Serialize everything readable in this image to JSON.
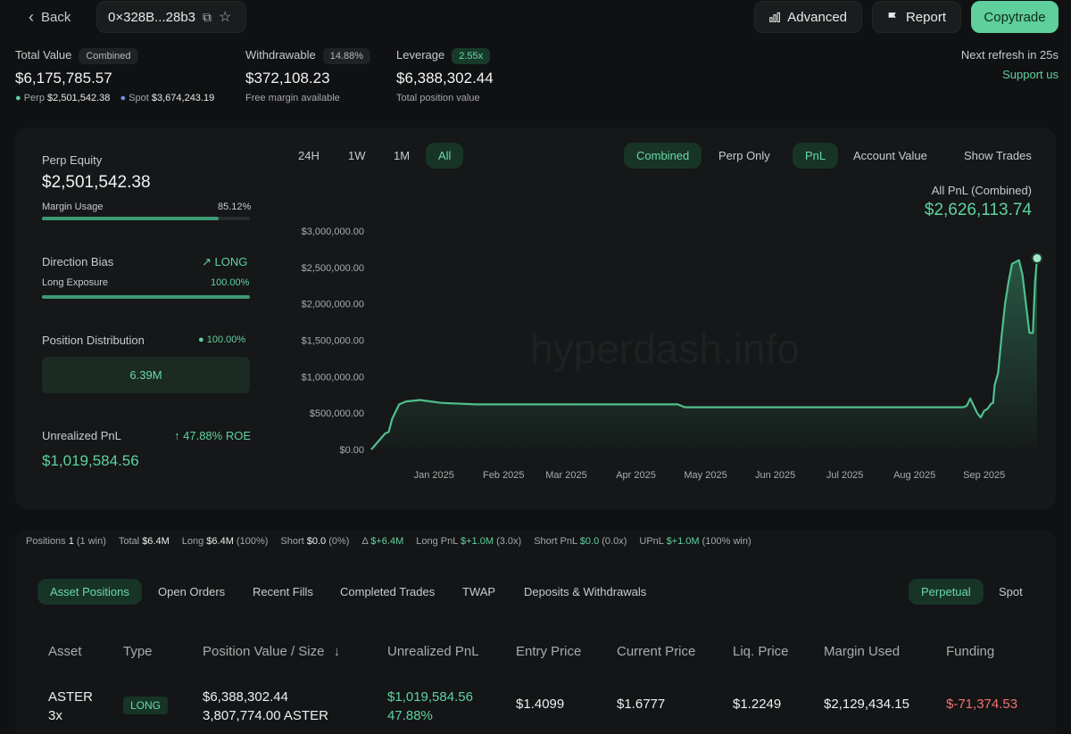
{
  "header": {
    "back_label": "Back",
    "address": "0×328B...28b3",
    "advanced_label": "Advanced",
    "report_label": "Report",
    "copytrade_label": "Copytrade",
    "refresh_text": "Next refresh in 25s",
    "support_label": "Support us"
  },
  "summary": {
    "total_value": {
      "label": "Total Value",
      "badge": "Combined",
      "value": "$6,175,785.57",
      "perp_label": "Perp",
      "perp_value": "$2,501,542.38",
      "spot_label": "Spot",
      "spot_value": "$3,674,243.19"
    },
    "withdrawable": {
      "label": "Withdrawable",
      "badge": "14.88%",
      "value": "$372,108.23",
      "sub": "Free margin available"
    },
    "leverage": {
      "label": "Leverage",
      "badge": "2.55x",
      "value": "$6,388,302.44",
      "sub": "Total position value"
    }
  },
  "left_panel": {
    "perp_equity_label": "Perp Equity",
    "perp_equity_value": "$2,501,542.38",
    "margin_usage_label": "Margin Usage",
    "margin_usage_value": "85.12%",
    "margin_usage_fraction": 0.8512,
    "direction_bias_label": "Direction Bias",
    "direction_bias_value": "LONG",
    "long_exposure_label": "Long Exposure",
    "long_exposure_value": "100.00%",
    "long_exposure_fraction": 1.0,
    "position_dist_label": "Position Distribution",
    "position_dist_value": "100.00%",
    "position_dist_box": "6.39M",
    "upnl_label": "Unrealized PnL",
    "upnl_roe": "47.88% ROE",
    "upnl_value": "$1,019,584.56"
  },
  "chart_controls": {
    "ranges": [
      "24H",
      "1W",
      "1M",
      "All"
    ],
    "active_range": "All",
    "modes": [
      "Combined",
      "Perp Only"
    ],
    "metrics": [
      "PnL",
      "Account Value"
    ],
    "show_trades_label": "Show Trades",
    "pnl_title": "All PnL (Combined)",
    "pnl_value": "$2,626,113.74",
    "watermark": "hyperdash.info"
  },
  "chart_data": {
    "type": "area",
    "ylim": [
      0,
      3000000
    ],
    "y_ticks": [
      "$3,000,000.00",
      "$2,500,000.00",
      "$2,000,000.00",
      "$1,500,000.00",
      "$1,000,000.00",
      "$500,000.00",
      "$0.00"
    ],
    "x_ticks": [
      "Jan 2025",
      "Feb 2025",
      "Mar 2025",
      "Apr 2025",
      "May 2025",
      "Jun 2025",
      "Jul 2025",
      "Aug 2025",
      "Sep 2025"
    ],
    "x_tick_pos": [
      0.9,
      1.9,
      2.8,
      3.8,
      4.8,
      5.8,
      6.8,
      7.8,
      8.8
    ],
    "x_domain": [
      0,
      9.56
    ],
    "series": [
      {
        "x": [
          0,
          0.1,
          0.2,
          0.25,
          0.3,
          0.4,
          0.5,
          0.7,
          1.0,
          1.5,
          2.5,
          3.5,
          4.4,
          4.5,
          5.5,
          6.5,
          7.5,
          8.5,
          8.55,
          8.6,
          8.65,
          8.7,
          8.75,
          8.8,
          8.85,
          8.9,
          8.93,
          8.95,
          9.0,
          9.05,
          9.1,
          9.15,
          9.2,
          9.3,
          9.35,
          9.4,
          9.45,
          9.5,
          9.53,
          9.56
        ],
        "y": [
          0,
          110000,
          220000,
          240000,
          420000,
          620000,
          660000,
          680000,
          640000,
          620000,
          620000,
          620000,
          620000,
          580000,
          580000,
          580000,
          580000,
          580000,
          600000,
          700000,
          600000,
          500000,
          440000,
          530000,
          560000,
          630000,
          640000,
          880000,
          1050000,
          1550000,
          2000000,
          2300000,
          2550000,
          2600000,
          2400000,
          2000000,
          1600000,
          1600000,
          2300000,
          2626113.74
        ]
      }
    ]
  },
  "stats_bar": [
    {
      "label": "Positions",
      "value": "1",
      "extra": "(1 win)"
    },
    {
      "label": "Total",
      "value": "$6.4M",
      "extra": ""
    },
    {
      "label": "Long",
      "value": "$6.4M",
      "extra": "(100%)"
    },
    {
      "label": "Short",
      "value": "$0.0",
      "extra": "(0%)"
    },
    {
      "label": "Δ",
      "value": "$+6.4M",
      "extra": "",
      "green": true
    },
    {
      "label": "Long PnL",
      "value": "$+1.0M",
      "extra": "(3.0x)",
      "green": true
    },
    {
      "label": "Short PnL",
      "value": "$0.0",
      "extra": "(0.0x)",
      "green": true
    },
    {
      "label": "UPnL",
      "value": "$+1.0M",
      "extra": "(100% win)",
      "green": true
    }
  ],
  "bottom_tabs": [
    "Asset Positions",
    "Open Orders",
    "Recent Fills",
    "Completed Trades",
    "TWAP",
    "Deposits & Withdrawals"
  ],
  "market_tabs": [
    "Perpetual",
    "Spot"
  ],
  "table": {
    "headers": [
      "Asset",
      "Type",
      "Position Value / Size",
      "Unrealized PnL",
      "Entry Price",
      "Current Price",
      "Liq. Price",
      "Margin Used",
      "Funding"
    ],
    "row": {
      "asset": "ASTER",
      "leverage": "3x",
      "type": "LONG",
      "position_value": "$6,388,302.44",
      "size": "3,807,774.00 ASTER",
      "upnl": "$1,019,584.56",
      "upnl_pct": "47.88%",
      "entry": "$1.4099",
      "current": "$1.6777",
      "liq": "$1.2249",
      "margin": "$2,129,434.15",
      "funding": "$-71,374.53"
    }
  },
  "colors": {
    "accent": "#5fd3a0",
    "line": "#4fbf8c",
    "negative": "#f07070"
  }
}
